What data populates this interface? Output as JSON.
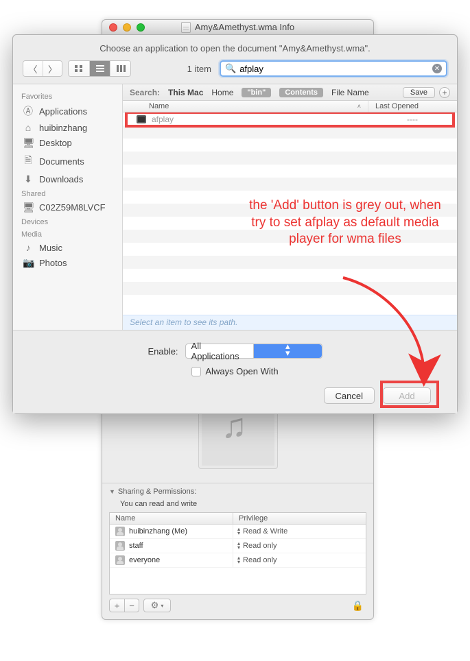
{
  "info_window": {
    "title": "Amy&Amethyst.wma Info",
    "sharing": {
      "header": "Sharing & Permissions:",
      "note": "You can read and write",
      "columns": {
        "name": "Name",
        "privilege": "Privilege"
      },
      "rows": [
        {
          "name": "huibinzhang (Me)",
          "priv": "Read & Write"
        },
        {
          "name": "staff",
          "priv": "Read only"
        },
        {
          "name": "everyone",
          "priv": "Read only"
        }
      ]
    }
  },
  "open_panel": {
    "prompt": "Choose an application to open the document \"Amy&Amethyst.wma\".",
    "item_count": "1 item",
    "search": {
      "value": "afplay",
      "placeholder": ""
    },
    "scope": {
      "label": "Search:",
      "this_mac": "This Mac",
      "home": "Home",
      "bin": "\"bin\"",
      "contents": "Contents",
      "file_name": "File Name",
      "save": "Save"
    },
    "list_header": {
      "name": "Name",
      "last": "Last Opened"
    },
    "results": [
      {
        "name": "afplay",
        "last": "----"
      }
    ],
    "pathbar": "Select an item to see its path.",
    "sidebar": {
      "favorites_label": "Favorites",
      "favorites": [
        {
          "icon": "A",
          "label": "Applications"
        },
        {
          "icon": "⌂",
          "label": "huibinzhang"
        },
        {
          "icon": "▭",
          "label": "Desktop"
        },
        {
          "icon": "🗎",
          "label": "Documents"
        },
        {
          "icon": "⬇",
          "label": "Downloads"
        }
      ],
      "shared_label": "Shared",
      "shared": [
        {
          "icon": "▭",
          "label": "C02Z59M8LVCF"
        }
      ],
      "devices_label": "Devices",
      "media_label": "Media",
      "media": [
        {
          "icon": "♪",
          "label": "Music"
        },
        {
          "icon": "📷",
          "label": "Photos"
        }
      ]
    },
    "bottom": {
      "enable_label": "Enable:",
      "enable_value": "All Applications",
      "always_label": "Always Open With",
      "cancel": "Cancel",
      "add": "Add"
    }
  },
  "annotation": {
    "text": "the 'Add' button is grey out, when try to set afplay as default media player for wma files"
  }
}
